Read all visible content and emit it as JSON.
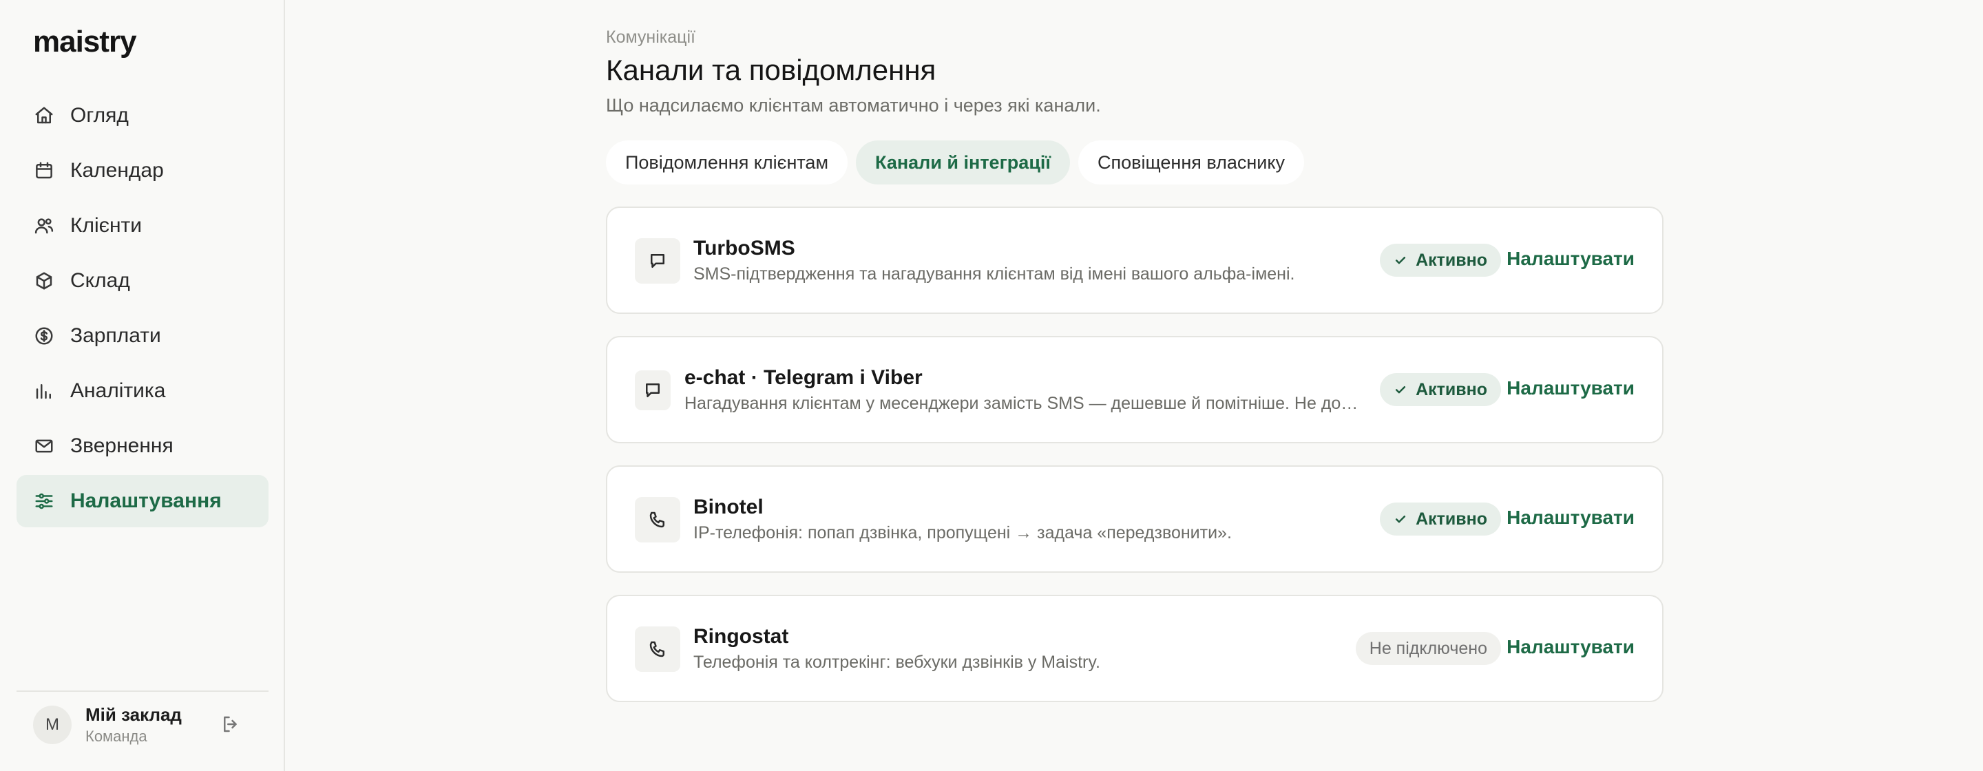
{
  "app": {
    "logo": "maistry"
  },
  "sidebar": {
    "items": [
      {
        "label": "Огляд",
        "icon": "home-icon"
      },
      {
        "label": "Календар",
        "icon": "calendar-icon"
      },
      {
        "label": "Клієнти",
        "icon": "users-icon"
      },
      {
        "label": "Склад",
        "icon": "box-icon"
      },
      {
        "label": "Зарплати",
        "icon": "dollar-icon"
      },
      {
        "label": "Аналітика",
        "icon": "bar-chart-icon"
      },
      {
        "label": "Звернення",
        "icon": "mail-icon"
      },
      {
        "label": "Налаштування",
        "icon": "sliders-icon",
        "active": true
      }
    ],
    "footer": {
      "avatar_initial": "М",
      "name": "Мій заклад",
      "role": "Команда"
    }
  },
  "page": {
    "breadcrumb": "Комунікації",
    "title": "Канали та повідомлення",
    "subtitle": "Що надсилаємо клієнтам автоматично і через які канали."
  },
  "tabs": [
    {
      "label": "Повідомлення клієнтам"
    },
    {
      "label": "Канали й інтеграції",
      "active": true
    },
    {
      "label": "Сповіщення власнику"
    }
  ],
  "integrations": [
    {
      "name": "TurboSMS",
      "description": "SMS-підтвердження та нагадування клієнтам від імені вашого альфа-імені.",
      "status": "Активно",
      "active": true,
      "action": "Налаштувати",
      "icon": "message-square-icon"
    },
    {
      "name": "e-chat · Telegram і Viber",
      "description": "Нагадування клієнтам у месенджери замість SMS — дешевше й помітніше. Не до…",
      "status": "Активно",
      "active": true,
      "action": "Налаштувати",
      "icon": "message-square-icon"
    },
    {
      "name": "Binotel",
      "description": "IP-телефонія: попап дзвінка, пропущені → задача «передзвонити».",
      "status": "Активно",
      "active": true,
      "action": "Налаштувати",
      "icon": "phone-icon"
    },
    {
      "name": "Ringostat",
      "description": "Телефонія та колтрекінг: вебхуки дзвінків у Maistry.",
      "status": "Не підключено",
      "active": false,
      "action": "Налаштувати",
      "icon": "phone-icon"
    }
  ],
  "colors": {
    "accent": "#1d6a46",
    "active_bg": "#e8efea",
    "background": "#f9f9f7"
  }
}
